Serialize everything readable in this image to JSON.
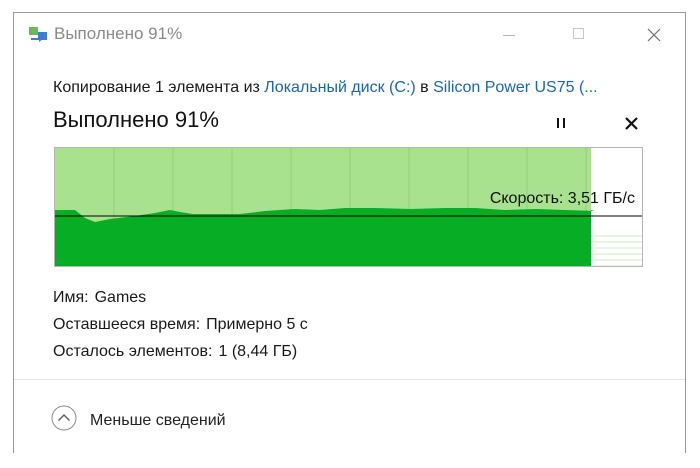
{
  "window": {
    "title": "Выполнено 91%"
  },
  "header": {
    "desc_prefix": "Копирование 1 элемента из ",
    "source": "Локальный диск (C:)",
    "desc_mid": " в ",
    "destination": "Silicon Power US75 (...",
    "progress_title": "Выполнено 91%",
    "progress_percent": 91
  },
  "graph": {
    "speed_label": "Скорость: 3,51 ГБ/с",
    "colors": {
      "light": "#a8e28e",
      "dark": "#06ad25",
      "grid": "#8fd07a",
      "line": "#000000"
    }
  },
  "details": {
    "name_key": "Имя:",
    "name_value": "Games",
    "time_key": "Оставшееся время:",
    "time_value": "Примерно 5 с",
    "items_key": "Осталось элементов:",
    "items_value": "1 (8,44 ГБ)"
  },
  "footer": {
    "fewer_label": "Меньше сведений"
  },
  "icons": {
    "title": "copy-transfer-icon",
    "minimize": "minimize-icon",
    "maximize": "maximize-icon",
    "close": "close-icon",
    "pause": "pause-icon",
    "cancel": "cancel-icon",
    "collapse": "chevron-up-icon"
  }
}
